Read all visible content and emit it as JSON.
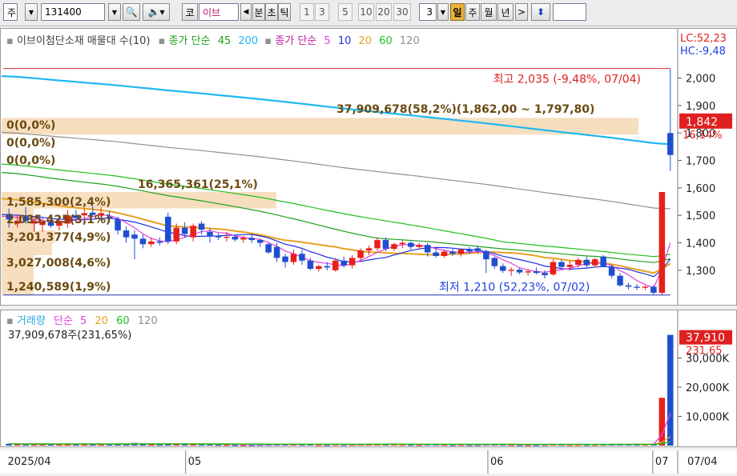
{
  "toolbar": {
    "market": "주",
    "code": "131400",
    "market_kr": "코",
    "stock_short": "이브",
    "period_buttons": [
      "분",
      "초",
      "틱",
      "1",
      "3",
      "5",
      "10",
      "20",
      "30"
    ],
    "interval_value": "3",
    "day_label": "일",
    "week_label": "주",
    "month_label": "월",
    "year_label": "년",
    "next_label": ">"
  },
  "price_panel": {
    "legend": {
      "name_item": "이브이첨단소재 매물대 수(10)",
      "ma_long_label": "종가 단순",
      "ma_long_periods": [
        "45",
        "200"
      ],
      "ma_short_label": "종가 단순",
      "ma_short_periods": [
        "5",
        "10",
        "20",
        "60",
        "120"
      ]
    },
    "lc_text": "LC:52,23",
    "hc_text": "HC:-9,48",
    "high_label": "최고 2,035 (-9,48%, 07/04)",
    "low_label": "최저 1,210 (52,23%, 07/02)",
    "current_price": "1,842",
    "current_change": "16,14%",
    "y_ticks": [
      "2,000",
      "1,900",
      "1,800",
      "1,700",
      "1,600",
      "1,500",
      "1,400",
      "1,300"
    ],
    "volume_profile": [
      {
        "label": "37,909,678(58,2%)(1,862,00 ~ 1,797,80)"
      },
      {
        "label": "0(0,0%)"
      },
      {
        "label": "0(0,0%)"
      },
      {
        "label": "0(0,0%)"
      },
      {
        "label": "16,365,361(25,1%)"
      },
      {
        "label": "1,585,300(2,4%)"
      },
      {
        "label": "2,035,425(3,1%)"
      },
      {
        "label": "3,201,377(4,9%)"
      },
      {
        "label": "3,027,008(4,6%)"
      },
      {
        "label": "1,240,589(1,9%)"
      }
    ]
  },
  "volume_panel": {
    "legend": {
      "name": "거래량",
      "ma_label": "단순",
      "ma_periods": [
        "5",
        "20",
        "60",
        "120"
      ]
    },
    "last_volume_text": "37,909,678주(231,65%)",
    "badge_value": "37,910",
    "badge_change": "231,65",
    "y_ticks": [
      "30,000K",
      "20,000K",
      "10,000K"
    ]
  },
  "x_axis": {
    "labels": [
      "2025/04",
      "05",
      "06",
      "07"
    ],
    "last_date": "07/04"
  },
  "colors": {
    "up": "#e8201c",
    "down": "#1f4fd0",
    "ma5": "#e040e0",
    "ma10": "#2030e0",
    "ma20": "#e8a020",
    "ma60": "#20c020",
    "ma120": "#909090",
    "ma45": "#20a020",
    "ma200": "#20b8f0",
    "profile": "#f4d8b4"
  },
  "chart_data": {
    "type": "candlestick",
    "y_range_price": [
      1180,
      2060
    ],
    "y_range_volume": [
      0,
      40000
    ],
    "volume_unit": "K",
    "candles": [
      {
        "o": 1505,
        "h": 1525,
        "l": 1455,
        "c": 1485,
        "v": 620
      },
      {
        "o": 1470,
        "h": 1500,
        "l": 1455,
        "c": 1480,
        "v": 540
      },
      {
        "o": 1495,
        "h": 1530,
        "l": 1470,
        "c": 1480,
        "v": 500
      },
      {
        "o": 1470,
        "h": 1495,
        "l": 1440,
        "c": 1480,
        "v": 560
      },
      {
        "o": 1465,
        "h": 1490,
        "l": 1440,
        "c": 1478,
        "v": 500
      },
      {
        "o": 1475,
        "h": 1505,
        "l": 1455,
        "c": 1462,
        "v": 520
      },
      {
        "o": 1462,
        "h": 1500,
        "l": 1445,
        "c": 1480,
        "v": 480
      },
      {
        "o": 1470,
        "h": 1520,
        "l": 1455,
        "c": 1500,
        "v": 560
      },
      {
        "o": 1500,
        "h": 1520,
        "l": 1475,
        "c": 1490,
        "v": 600
      },
      {
        "o": 1500,
        "h": 1525,
        "l": 1475,
        "c": 1508,
        "v": 640
      },
      {
        "o": 1510,
        "h": 1535,
        "l": 1495,
        "c": 1502,
        "v": 520
      },
      {
        "o": 1500,
        "h": 1530,
        "l": 1480,
        "c": 1508,
        "v": 480
      },
      {
        "o": 1495,
        "h": 1515,
        "l": 1475,
        "c": 1488,
        "v": 420
      },
      {
        "o": 1485,
        "h": 1495,
        "l": 1430,
        "c": 1445,
        "v": 680
      },
      {
        "o": 1445,
        "h": 1460,
        "l": 1400,
        "c": 1420,
        "v": 620
      },
      {
        "o": 1430,
        "h": 1445,
        "l": 1340,
        "c": 1415,
        "v": 900
      },
      {
        "o": 1415,
        "h": 1430,
        "l": 1380,
        "c": 1395,
        "v": 560
      },
      {
        "o": 1395,
        "h": 1420,
        "l": 1385,
        "c": 1405,
        "v": 400
      },
      {
        "o": 1405,
        "h": 1420,
        "l": 1390,
        "c": 1400,
        "v": 380
      },
      {
        "o": 1495,
        "h": 1510,
        "l": 1395,
        "c": 1405,
        "v": 780
      },
      {
        "o": 1405,
        "h": 1470,
        "l": 1395,
        "c": 1455,
        "v": 600
      },
      {
        "o": 1455,
        "h": 1475,
        "l": 1420,
        "c": 1432,
        "v": 540
      },
      {
        "o": 1420,
        "h": 1470,
        "l": 1405,
        "c": 1462,
        "v": 520
      },
      {
        "o": 1470,
        "h": 1480,
        "l": 1430,
        "c": 1448,
        "v": 460
      },
      {
        "o": 1440,
        "h": 1455,
        "l": 1400,
        "c": 1425,
        "v": 480
      },
      {
        "o": 1425,
        "h": 1435,
        "l": 1410,
        "c": 1420,
        "v": 360
      },
      {
        "o": 1420,
        "h": 1440,
        "l": 1405,
        "c": 1422,
        "v": 340
      },
      {
        "o": 1422,
        "h": 1430,
        "l": 1405,
        "c": 1412,
        "v": 300
      },
      {
        "o": 1412,
        "h": 1425,
        "l": 1400,
        "c": 1418,
        "v": 280
      },
      {
        "o": 1418,
        "h": 1430,
        "l": 1400,
        "c": 1410,
        "v": 300
      },
      {
        "o": 1410,
        "h": 1415,
        "l": 1385,
        "c": 1400,
        "v": 320
      },
      {
        "o": 1395,
        "h": 1400,
        "l": 1360,
        "c": 1365,
        "v": 380
      },
      {
        "o": 1385,
        "h": 1400,
        "l": 1330,
        "c": 1345,
        "v": 460
      },
      {
        "o": 1350,
        "h": 1360,
        "l": 1310,
        "c": 1330,
        "v": 500
      },
      {
        "o": 1330,
        "h": 1375,
        "l": 1320,
        "c": 1360,
        "v": 420
      },
      {
        "o": 1360,
        "h": 1375,
        "l": 1320,
        "c": 1335,
        "v": 380
      },
      {
        "o": 1335,
        "h": 1345,
        "l": 1300,
        "c": 1305,
        "v": 420
      },
      {
        "o": 1305,
        "h": 1320,
        "l": 1295,
        "c": 1315,
        "v": 340
      },
      {
        "o": 1315,
        "h": 1330,
        "l": 1300,
        "c": 1310,
        "v": 300
      },
      {
        "o": 1300,
        "h": 1345,
        "l": 1295,
        "c": 1335,
        "v": 380
      },
      {
        "o": 1335,
        "h": 1350,
        "l": 1310,
        "c": 1318,
        "v": 340
      },
      {
        "o": 1318,
        "h": 1355,
        "l": 1305,
        "c": 1345,
        "v": 380
      },
      {
        "o": 1345,
        "h": 1380,
        "l": 1330,
        "c": 1372,
        "v": 520
      },
      {
        "o": 1372,
        "h": 1390,
        "l": 1355,
        "c": 1380,
        "v": 480
      },
      {
        "o": 1380,
        "h": 1420,
        "l": 1370,
        "c": 1410,
        "v": 640
      },
      {
        "o": 1410,
        "h": 1420,
        "l": 1370,
        "c": 1378,
        "v": 560
      },
      {
        "o": 1378,
        "h": 1400,
        "l": 1370,
        "c": 1395,
        "v": 420
      },
      {
        "o": 1395,
        "h": 1410,
        "l": 1380,
        "c": 1400,
        "v": 380
      },
      {
        "o": 1400,
        "h": 1405,
        "l": 1375,
        "c": 1385,
        "v": 340
      },
      {
        "o": 1385,
        "h": 1400,
        "l": 1375,
        "c": 1392,
        "v": 320
      },
      {
        "o": 1392,
        "h": 1400,
        "l": 1350,
        "c": 1365,
        "v": 460
      },
      {
        "o": 1365,
        "h": 1380,
        "l": 1345,
        "c": 1352,
        "v": 420
      },
      {
        "o": 1352,
        "h": 1375,
        "l": 1345,
        "c": 1368,
        "v": 360
      },
      {
        "o": 1368,
        "h": 1380,
        "l": 1352,
        "c": 1360,
        "v": 320
      },
      {
        "o": 1360,
        "h": 1380,
        "l": 1350,
        "c": 1375,
        "v": 340
      },
      {
        "o": 1375,
        "h": 1385,
        "l": 1360,
        "c": 1368,
        "v": 300
      },
      {
        "o": 1380,
        "h": 1390,
        "l": 1360,
        "c": 1370,
        "v": 320
      },
      {
        "o": 1370,
        "h": 1375,
        "l": 1290,
        "c": 1340,
        "v": 480
      },
      {
        "o": 1345,
        "h": 1350,
        "l": 1305,
        "c": 1315,
        "v": 420
      },
      {
        "o": 1315,
        "h": 1325,
        "l": 1290,
        "c": 1298,
        "v": 380
      },
      {
        "o": 1298,
        "h": 1310,
        "l": 1280,
        "c": 1302,
        "v": 320
      },
      {
        "o": 1302,
        "h": 1310,
        "l": 1285,
        "c": 1292,
        "v": 300
      },
      {
        "o": 1292,
        "h": 1305,
        "l": 1280,
        "c": 1296,
        "v": 280
      },
      {
        "o": 1296,
        "h": 1310,
        "l": 1285,
        "c": 1290,
        "v": 300
      },
      {
        "o": 1290,
        "h": 1300,
        "l": 1270,
        "c": 1282,
        "v": 340
      },
      {
        "o": 1285,
        "h": 1340,
        "l": 1280,
        "c": 1330,
        "v": 460
      },
      {
        "o": 1330,
        "h": 1340,
        "l": 1305,
        "c": 1312,
        "v": 380
      },
      {
        "o": 1312,
        "h": 1335,
        "l": 1300,
        "c": 1320,
        "v": 340
      },
      {
        "o": 1320,
        "h": 1345,
        "l": 1310,
        "c": 1338,
        "v": 360
      },
      {
        "o": 1338,
        "h": 1350,
        "l": 1310,
        "c": 1318,
        "v": 340
      },
      {
        "o": 1318,
        "h": 1345,
        "l": 1310,
        "c": 1340,
        "v": 360
      },
      {
        "o": 1350,
        "h": 1355,
        "l": 1310,
        "c": 1312,
        "v": 420
      },
      {
        "o": 1312,
        "h": 1320,
        "l": 1270,
        "c": 1280,
        "v": 480
      },
      {
        "o": 1280,
        "h": 1290,
        "l": 1240,
        "c": 1245,
        "v": 520
      },
      {
        "o": 1245,
        "h": 1255,
        "l": 1230,
        "c": 1240,
        "v": 460
      },
      {
        "o": 1240,
        "h": 1250,
        "l": 1228,
        "c": 1236,
        "v": 500
      },
      {
        "o": 1236,
        "h": 1245,
        "l": 1228,
        "c": 1240,
        "v": 420
      },
      {
        "o": 1240,
        "h": 1245,
        "l": 1210,
        "c": 1218,
        "v": 620
      },
      {
        "o": 1218,
        "h": 1585,
        "l": 1210,
        "c": 1585,
        "v": 16365
      },
      {
        "o": 1800,
        "h": 2035,
        "l": 1662,
        "c": 1720,
        "v": 37910
      }
    ]
  }
}
